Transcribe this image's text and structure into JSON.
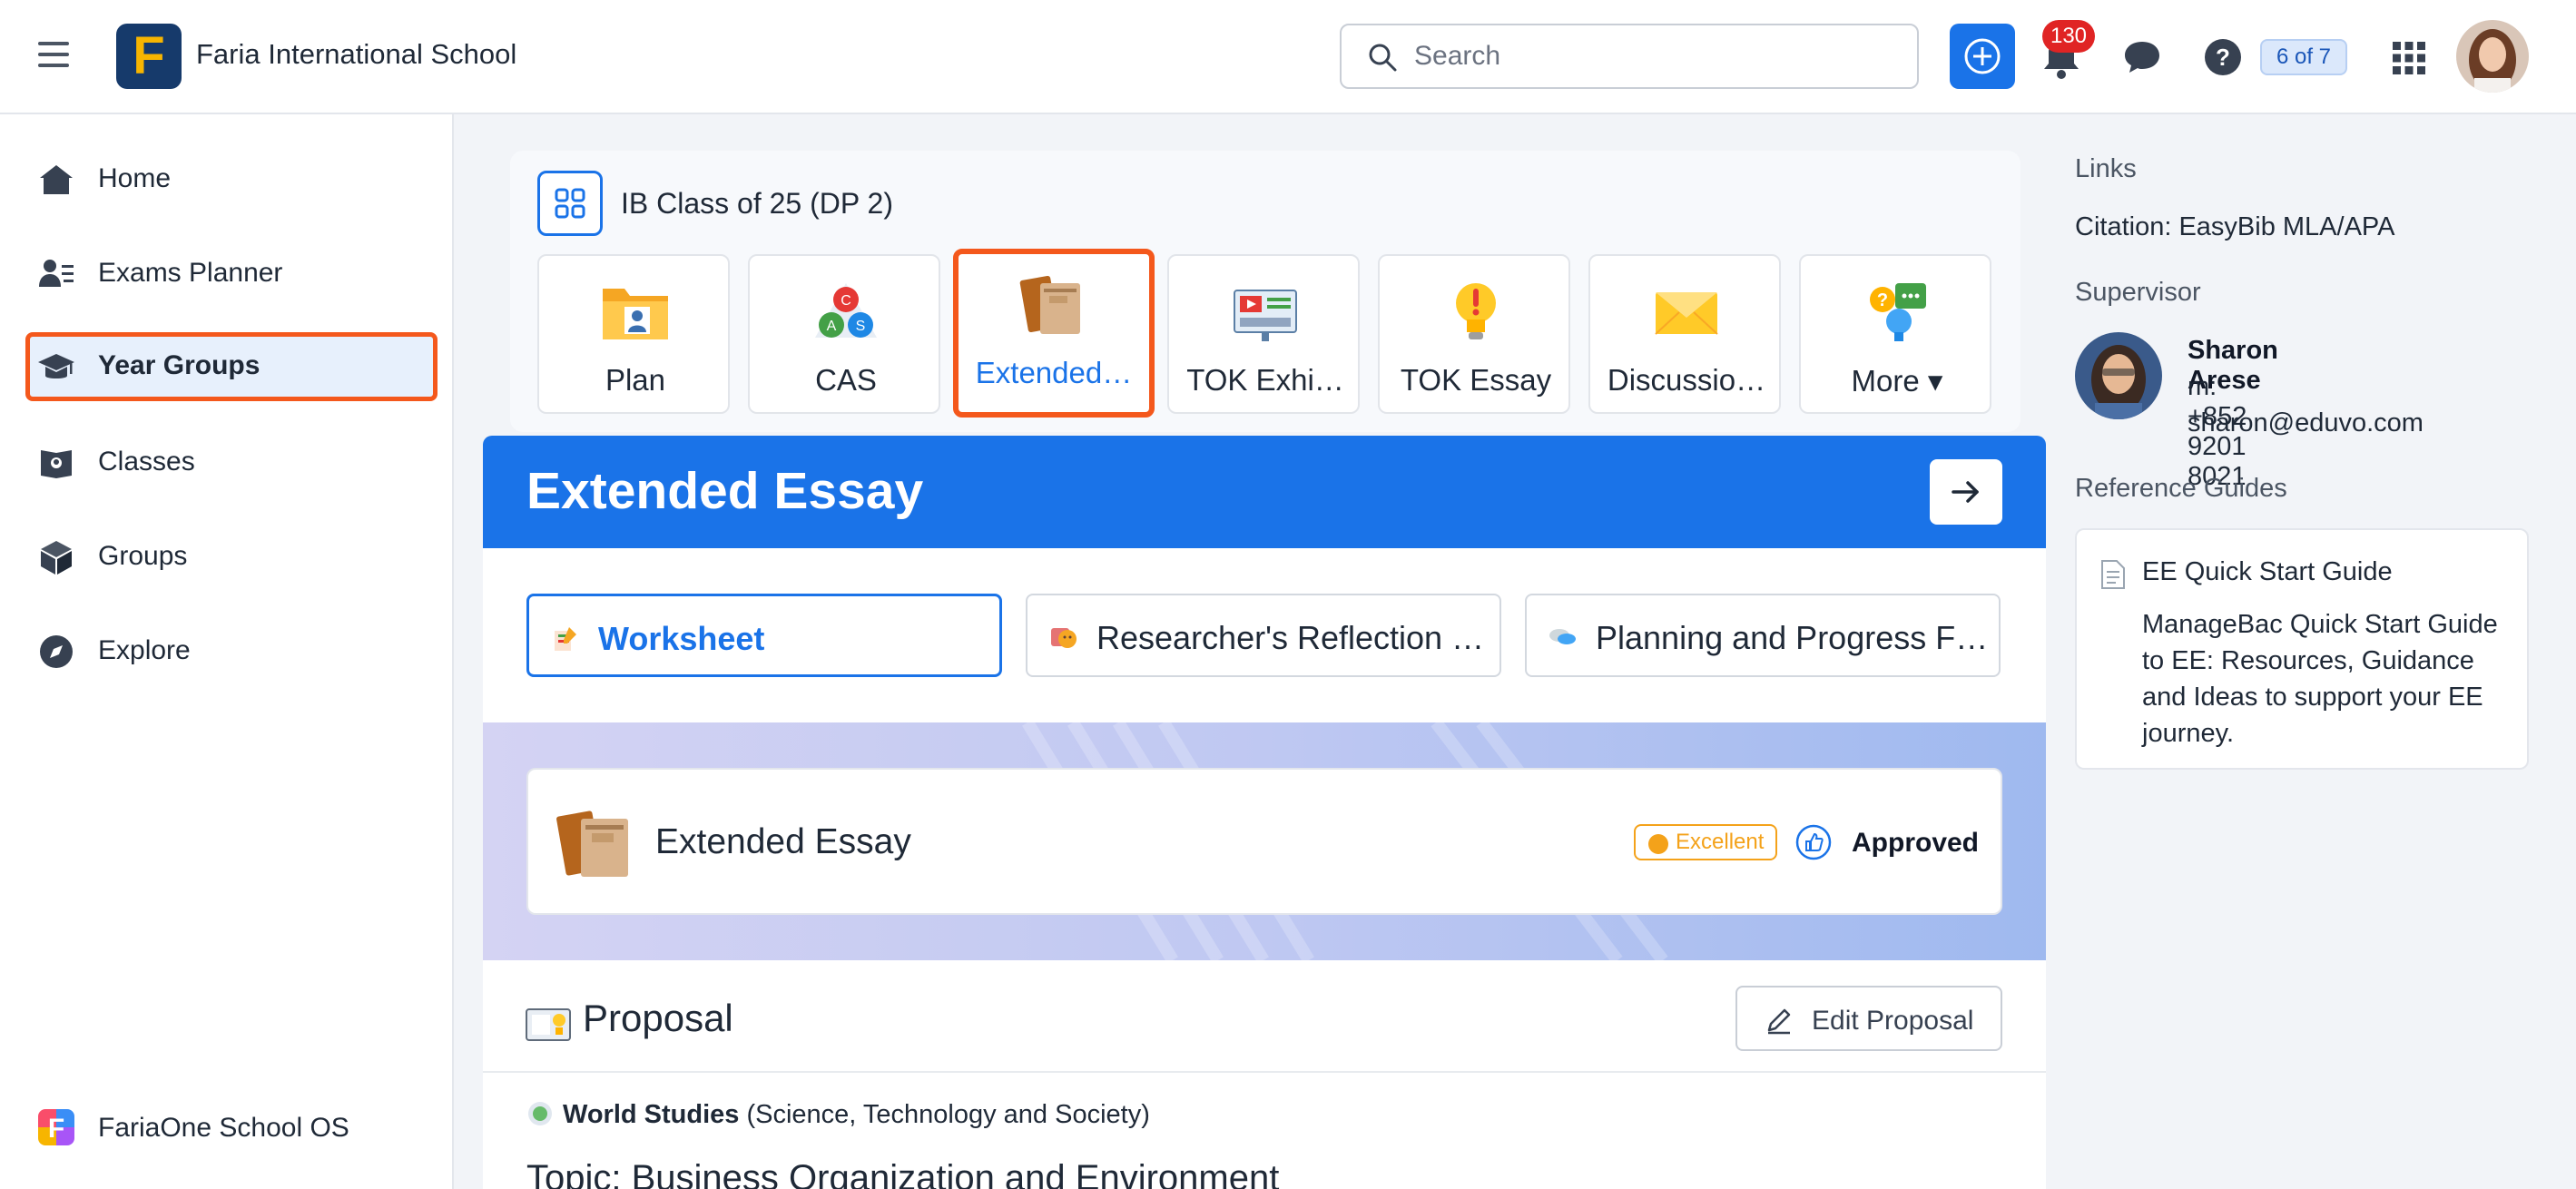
{
  "header": {
    "school_name": "Faria International School",
    "logo_letter": "F",
    "search": {
      "placeholder": "Search"
    },
    "notifications_count": "130",
    "progress_label": "6 of 7"
  },
  "sidebar": {
    "items": [
      {
        "label": "Home",
        "icon": "home-icon"
      },
      {
        "label": "Exams Planner",
        "icon": "exams-planner-icon"
      },
      {
        "label": "Year Groups",
        "icon": "graduation-cap-icon",
        "active": true
      },
      {
        "label": "Classes",
        "icon": "classes-book-icon"
      },
      {
        "label": "Groups",
        "icon": "cube-icon"
      },
      {
        "label": "Explore",
        "icon": "compass-icon"
      }
    ],
    "footer": {
      "label": "FariaOne School OS"
    }
  },
  "year_group": {
    "title": "IB Class of 25 (DP 2)",
    "tiles": [
      {
        "label": "Plan",
        "icon": "plan-folder-icon"
      },
      {
        "label": "CAS",
        "icon": "cas-triangle-icon"
      },
      {
        "label": "Extended…",
        "icon": "extended-essay-books-icon",
        "active": true
      },
      {
        "label": "TOK Exhi…",
        "icon": "tok-exhibition-icon"
      },
      {
        "label": "TOK Essay",
        "icon": "lightbulb-icon"
      },
      {
        "label": "Discussio…",
        "icon": "envelope-icon"
      },
      {
        "label": "More ▾",
        "icon": "more-apps-icon"
      }
    ]
  },
  "main": {
    "title": "Extended Essay",
    "tabs": [
      {
        "label": "Worksheet",
        "active": true
      },
      {
        "label": "Researcher's Reflection …"
      },
      {
        "label": "Planning and Progress F…"
      }
    ],
    "card": {
      "name": "Extended Essay",
      "grade_badge": "Excellent",
      "status": "Approved"
    },
    "proposal": {
      "title": "Proposal",
      "edit_label": "Edit Proposal",
      "subject_bold": "World Studies",
      "subject_rest": " (Science, Technology and Society)",
      "topic": "Topic: Business Organization and Environment"
    }
  },
  "right_panel": {
    "links_heading": "Links",
    "citation": "Citation: EasyBib MLA/APA",
    "supervisor_heading": "Supervisor",
    "supervisor": {
      "name": "Sharon Arese",
      "phone": "m: +852 9201 8021",
      "email": "sharon@eduvo.com"
    },
    "reference_heading": "Reference Guides",
    "guide": {
      "title": "EE Quick Start Guide",
      "description": "ManageBac Quick Start Guide to EE: Resources, Guidance and Ideas to support your EE journey."
    }
  },
  "colors": {
    "primary": "#1a73e8",
    "highlight": "#f4581c",
    "badge": "#e02424",
    "excellent": "#f4a21a"
  }
}
